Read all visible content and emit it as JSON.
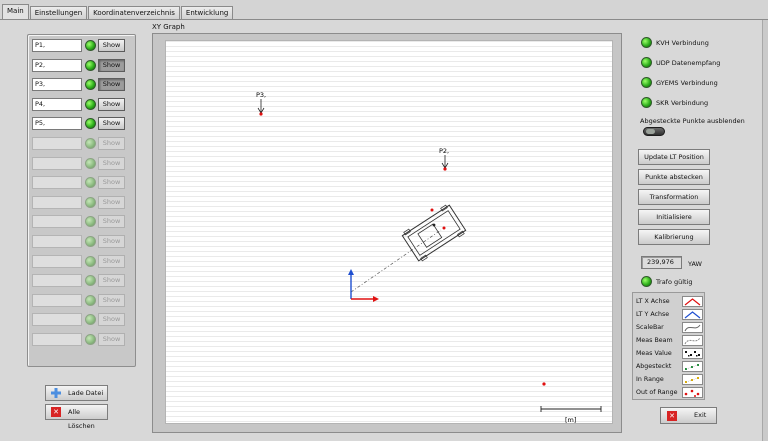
{
  "tabs": [
    {
      "label": "Main",
      "active": true
    },
    {
      "label": "Einstellungen",
      "active": false
    },
    {
      "label": "Koordinatenverzeichnis",
      "active": false
    },
    {
      "label": "Entwicklung",
      "active": false
    }
  ],
  "points": [
    {
      "name": "P1,",
      "show": "Show",
      "enabled": true,
      "pressed": false
    },
    {
      "name": "P2,",
      "show": "Show",
      "enabled": true,
      "pressed": true
    },
    {
      "name": "P3,",
      "show": "Show",
      "enabled": true,
      "pressed": true
    },
    {
      "name": "P4,",
      "show": "Show",
      "enabled": true,
      "pressed": false
    },
    {
      "name": "P5,",
      "show": "Show",
      "enabled": true,
      "pressed": false
    },
    {
      "name": "",
      "show": "Show",
      "enabled": false
    },
    {
      "name": "",
      "show": "Show",
      "enabled": false
    },
    {
      "name": "",
      "show": "Show",
      "enabled": false
    },
    {
      "name": "",
      "show": "Show",
      "enabled": false
    },
    {
      "name": "",
      "show": "Show",
      "enabled": false
    },
    {
      "name": "",
      "show": "Show",
      "enabled": false
    },
    {
      "name": "",
      "show": "Show",
      "enabled": false
    },
    {
      "name": "",
      "show": "Show",
      "enabled": false
    },
    {
      "name": "",
      "show": "Show",
      "enabled": false
    },
    {
      "name": "",
      "show": "Show",
      "enabled": false
    },
    {
      "name": "",
      "show": "Show",
      "enabled": false
    }
  ],
  "left_buttons": {
    "load": "Lade Datei",
    "clear": "Alle Löschen"
  },
  "graph": {
    "title": "XY Graph",
    "scale_label": "[m]",
    "point_labels": {
      "p3": "P3,",
      "p2": "P2,"
    }
  },
  "status": [
    {
      "label": "KVH Verbindung"
    },
    {
      "label": "UDP Datenempfang"
    },
    {
      "label": "GYEMS Verbindung"
    },
    {
      "label": "SKR Verbindung"
    }
  ],
  "hide_points_label": "Abgesteckte Punkte ausblenden",
  "actions": [
    {
      "label": "Update LT Position"
    },
    {
      "label": "Punkte abstecken"
    },
    {
      "label": "Transformation"
    },
    {
      "label": "Initialisiere"
    },
    {
      "label": "Kalibrierung"
    }
  ],
  "yaw": {
    "value": "239,976",
    "label": "YAW"
  },
  "trafo": {
    "label": "Trafo gültig"
  },
  "legend": [
    {
      "label": "LT X Achse",
      "icon": "red-line"
    },
    {
      "label": "LT Y Achse",
      "icon": "blue-line"
    },
    {
      "label": "ScaleBar",
      "icon": "grey-line"
    },
    {
      "label": "Meas Beam",
      "icon": "grey-dashed-line"
    },
    {
      "label": "Meas Value",
      "icon": "black-dots"
    },
    {
      "label": "Abgesteckt",
      "icon": "green-dots"
    },
    {
      "label": "In Range",
      "icon": "yellow-dots"
    },
    {
      "label": "Out of Range",
      "icon": "red-dots"
    }
  ],
  "exit": "Exit",
  "colors": {
    "accent_red": "#e01010",
    "accent_blue": "#1f4fd0",
    "led_green": "#2fb01c"
  }
}
